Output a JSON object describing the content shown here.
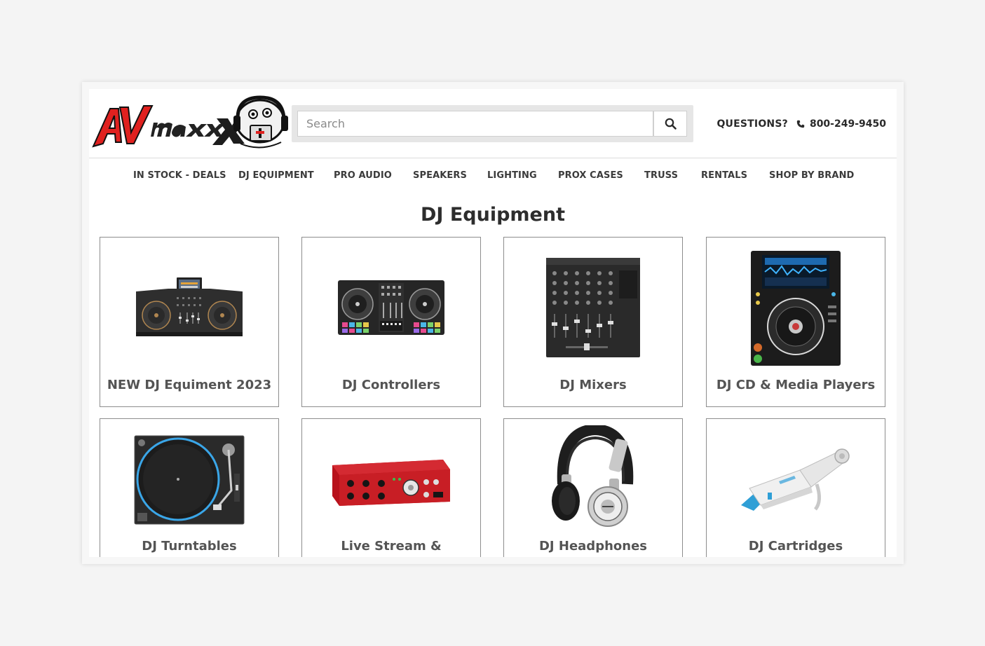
{
  "header": {
    "logo_text": "AVmaxx",
    "search": {
      "placeholder": "Search",
      "value": ""
    },
    "questions_label": "QUESTIONS?",
    "phone": "800-249-9450"
  },
  "nav": {
    "items": [
      {
        "label": "IN STOCK - DEALS"
      },
      {
        "label": "DJ EQUIPMENT"
      },
      {
        "label": "PRO AUDIO"
      },
      {
        "label": "SPEAKERS"
      },
      {
        "label": "LIGHTING"
      },
      {
        "label": "PROX CASES"
      },
      {
        "label": "TRUSS"
      },
      {
        "label": "RENTALS"
      },
      {
        "label": "SHOP BY BRAND"
      }
    ]
  },
  "main": {
    "title": "DJ Equipment",
    "categories": [
      {
        "label": "NEW DJ Equiment 2023",
        "icon": "dj-system-image"
      },
      {
        "label": "DJ Controllers",
        "icon": "dj-controller-image"
      },
      {
        "label": "DJ Mixers",
        "icon": "dj-mixer-image"
      },
      {
        "label": "DJ CD & Media Players",
        "icon": "media-player-image"
      },
      {
        "label": "DJ Turntables",
        "icon": "turntable-image"
      },
      {
        "label": "Live Stream &",
        "icon": "audio-interface-image"
      },
      {
        "label": "DJ Headphones",
        "icon": "headphones-image"
      },
      {
        "label": "DJ Cartridges",
        "icon": "cartridge-image"
      }
    ]
  },
  "colors": {
    "logo_red": "#e0211f",
    "interface_red": "#c81e25",
    "text_dark": "#2d2d2d",
    "text_card": "#545454"
  }
}
